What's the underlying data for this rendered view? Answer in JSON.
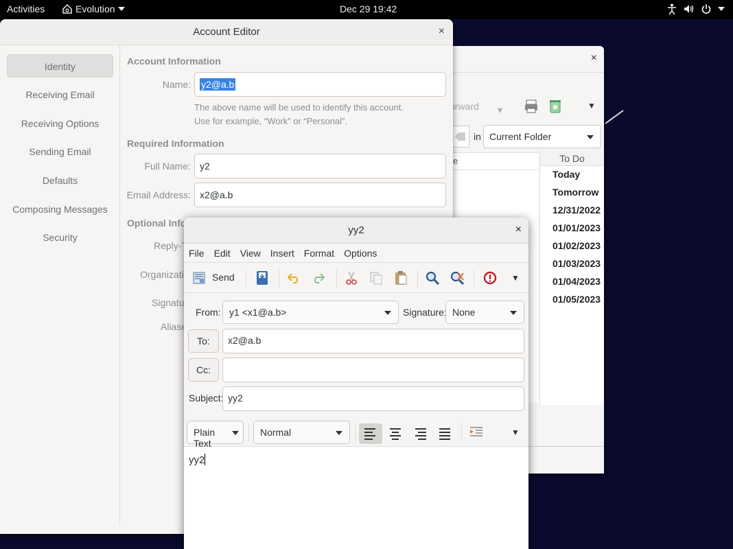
{
  "topbar": {
    "activities": "Activities",
    "app_name": "Evolution",
    "clock": "Dec 29  19:42"
  },
  "background_window": {
    "forward_label": "orward",
    "search_in": "in",
    "folder_scope": "Current Folder",
    "list_header_fragment": "e",
    "todo": {
      "header": "To Do",
      "items": [
        "Today",
        "Tomorrow",
        "12/31/2022",
        "01/01/2023",
        "01/02/2023",
        "01/03/2023",
        "01/04/2023",
        "01/05/2023"
      ]
    }
  },
  "account_editor": {
    "title": "Account Editor",
    "sidebar": [
      "Identity",
      "Receiving Email",
      "Receiving Options",
      "Sending Email",
      "Defaults",
      "Composing Messages",
      "Security"
    ],
    "account_info_title": "Account Information",
    "name_label": "Name:",
    "name_value": "y2@a.b",
    "hint_line1": "The above name will be used to identify this account.",
    "hint_line2": "Use for example, “Work” or “Personal”.",
    "required_title": "Required Information",
    "fullname_label": "Full Name:",
    "fullname_value": "y2",
    "email_label": "Email Address:",
    "email_value": "x2@a.b",
    "optional_title": "Optional Inform",
    "replyto_label": "Reply-T",
    "org_label": "Organizatio",
    "signature_label": "Signatur",
    "aliases_label": "Aliase"
  },
  "compose": {
    "title": "yy2",
    "menu": [
      "File",
      "Edit",
      "View",
      "Insert",
      "Format",
      "Options"
    ],
    "send_label": "Send",
    "from_label": "From:",
    "from_value": "y1 <x1@a.b>",
    "signature_label": "Signature:",
    "signature_value": "None",
    "to_button": "To:",
    "to_value": "x2@a.b",
    "cc_button": "Cc:",
    "cc_value": "",
    "subject_label": "Subject:",
    "subject_value": "yy2",
    "format_mode": "Plain Text",
    "paragraph_style": "Normal",
    "body_text": "yy2"
  }
}
